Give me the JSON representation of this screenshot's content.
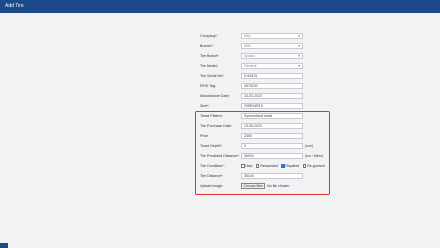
{
  "header": {
    "title": "Add Tire"
  },
  "form": {
    "company": {
      "label": "Company*:",
      "value": "ABC"
    },
    "branch": {
      "label": "Branch*:",
      "value": "ABC"
    },
    "tire_brand": {
      "label": "Tire Brand*:",
      "value": "Apolus"
    },
    "tire_model": {
      "label": "Tire Model:",
      "value": "General"
    },
    "serial_no": {
      "label": "Tire Serial No*:",
      "value": "D 69475"
    },
    "rfid_tag": {
      "label": "RFID Tag:",
      "value": "4578232"
    },
    "manufacture_date": {
      "label": "Manufacture Date:",
      "value": "10-03-2023"
    },
    "size": {
      "label": "Size*:",
      "value": "205R16R15"
    },
    "tread_pattern": {
      "label": "Tread Pattern:",
      "value": "Symmetrical tread"
    },
    "purchase_date": {
      "label": "Tire Purchase Date:",
      "value": "13-05-2023"
    },
    "price": {
      "label": "Price:",
      "value": "2350"
    },
    "tread_depth": {
      "label": "Tread Depth*:",
      "value": "9",
      "unit": "(mm)"
    },
    "predicted_distance": {
      "label": "Tire Predicted Distance*:",
      "value": "36000",
      "unit": "(km / Miles)"
    },
    "condition": {
      "label": "Tire Condition*:",
      "options": [
        {
          "label": "New",
          "checked": false
        },
        {
          "label": "Remoulded",
          "checked": false
        },
        {
          "label": "Repaired",
          "checked": true
        },
        {
          "label": "Re-grooved",
          "checked": false
        }
      ]
    },
    "distance": {
      "label": "Tire Distance*:",
      "value": "35100"
    },
    "upload": {
      "label": "Upload image:",
      "button": "Choose files",
      "status": "No file chosen"
    }
  }
}
